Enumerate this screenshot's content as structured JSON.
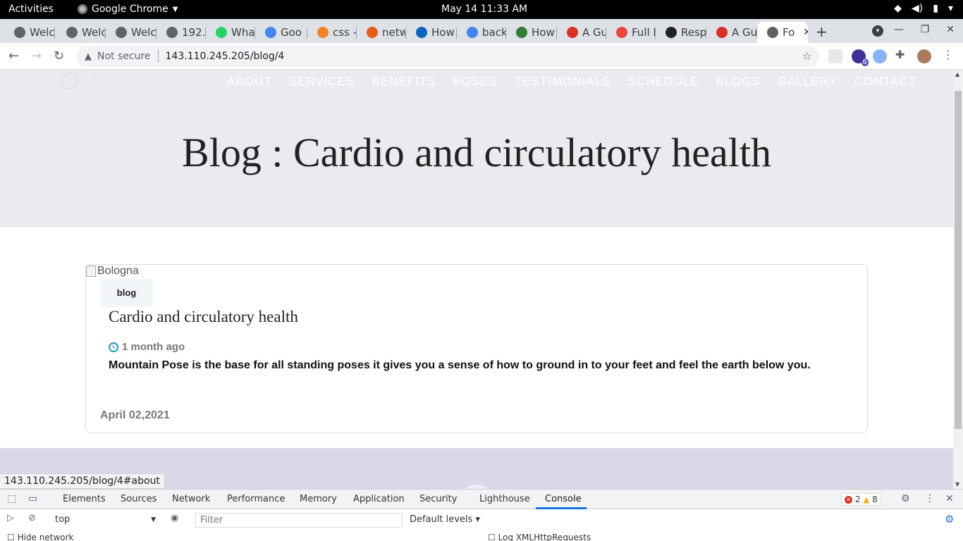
{
  "system_bar": {
    "activities": "Activities",
    "app_name": "Google Chrome",
    "clock": "May 14  11:33 AM"
  },
  "tabs": [
    {
      "label": "Welc",
      "favicon_color": "#5f6368"
    },
    {
      "label": "Welc",
      "favicon_color": "#5f6368"
    },
    {
      "label": "Welc",
      "favicon_color": "#5f6368"
    },
    {
      "label": "192.",
      "favicon_color": "#5f6368"
    },
    {
      "label": "Wha",
      "favicon_color": "#25d366"
    },
    {
      "label": "Goo",
      "favicon_color": "#4285f4"
    },
    {
      "label": "css -",
      "favicon_color": "#f48024"
    },
    {
      "label": "netw",
      "favicon_color": "#e65c17"
    },
    {
      "label": "How",
      "favicon_color": "#0a66c2"
    },
    {
      "label": "back",
      "favicon_color": "#4285f4"
    },
    {
      "label": "How",
      "favicon_color": "#2e7d32"
    },
    {
      "label": "A Gu",
      "favicon_color": "#d93025"
    },
    {
      "label": "Full I",
      "favicon_color": "#e8453c"
    },
    {
      "label": "Resp",
      "favicon_color": "#222222"
    },
    {
      "label": "A Gu",
      "favicon_color": "#d93025"
    },
    {
      "label": "Fo",
      "favicon_color": "#5f6368"
    }
  ],
  "toolbar": {
    "not_secure": "Not secure",
    "url": "143.110.245.205/blog/4",
    "extension_badge": "6"
  },
  "site": {
    "nav": [
      "ABOUT",
      "SERVICES",
      "BENEFITS",
      "POSES",
      "TESTIMONIALS",
      "SCHEDULE",
      "BLOGS",
      "GALLERY",
      "CONTACT"
    ],
    "heading": "Blog : Cardio and circulatory health",
    "card": {
      "image_alt": "Bologna",
      "badge": "blog",
      "title": "Cardio and circulatory health",
      "time_ago": "1 month ago",
      "excerpt": "Mountain Pose is the base for all standing poses it gives you a sense of how to ground in to your feet and feel the earth below you.",
      "date": "April 02,2021"
    }
  },
  "status_url": "143.110.245.205/blog/4#about",
  "devtools": {
    "tabs": [
      "Elements",
      "Sources",
      "Network",
      "Performance",
      "Memory",
      "Application",
      "Security",
      "Lighthouse",
      "Console"
    ],
    "active_tab": "Console",
    "error_count": "2",
    "warning_count": "8",
    "context": "top",
    "filter_placeholder": "Filter",
    "levels": "Default levels",
    "row3_left": "Hide network",
    "row3_right": "Log XMLHttpRequests"
  }
}
